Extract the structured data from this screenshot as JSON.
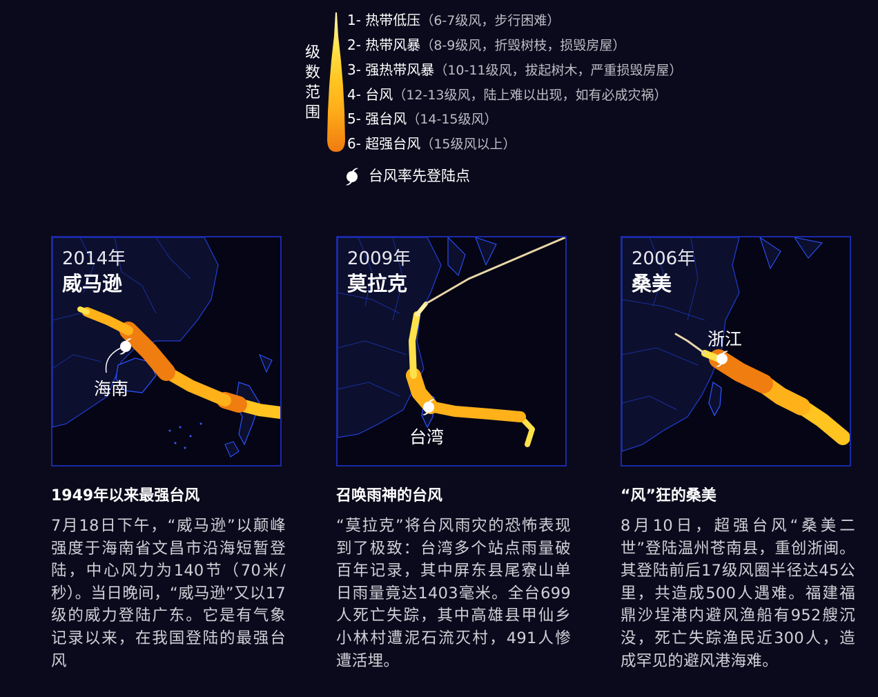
{
  "legend": {
    "title_chars": [
      "级",
      "数",
      "范",
      "围"
    ],
    "levels": [
      {
        "level": "1- 热带低压",
        "desc": "（6-7级风，步行困难）",
        "color": "#fff2a6"
      },
      {
        "level": "2- 热带风暴",
        "desc": "（8-9级风，折毁树枝，损毁房屋）",
        "color": "#ffe14a"
      },
      {
        "level": "3- 强热带风暴",
        "desc": "（10-11级风，拔起树木，严重损毁房屋）",
        "color": "#ffcb1f"
      },
      {
        "level": "4- 台风",
        "desc": "（12-13级风，陆上难以出现，如有必成灾祸）",
        "color": "#ffb11a"
      },
      {
        "level": "5- 强台风",
        "desc": "（14-15级风）",
        "color": "#f99a14"
      },
      {
        "level": "6- 超强台风",
        "desc": "（15级风以上）",
        "color": "#ef7d0f"
      }
    ],
    "landfall_label": "台风率先登陆点",
    "landfall_icon": "typhoon-landfall-icon"
  },
  "cards": [
    {
      "year": "2014年",
      "name": "威马逊",
      "place": "海南",
      "headline": "1949年以来最强台风",
      "body": "7月18日下午，“威马逊”以颠峰强度于海南省文昌市沿海短暂登陆，中心风力为140节（70米/秒）。当日晚间，“威马逊”又以17级的威力登陆广东。它是有气象记录以来，在我国登陆的最强台风"
    },
    {
      "year": "2009年",
      "name": "莫拉克",
      "place": "台湾",
      "headline": "召唤雨神的台风",
      "body": "“莫拉克”将台风雨灾的恐怖表现到了极致：台湾多个站点雨量破百年记录，其中屏东县尾寮山单日雨量竟达1403毫米。全台699人死亡失踪，其中高雄县甲仙乡小林村遭泥石流灭村，491人惨遭活埋。"
    },
    {
      "year": "2006年",
      "name": "桑美",
      "place": "浙江",
      "headline": "“风”狂的桑美",
      "body": "8月10日，超强台风“桑美二世”登陆温州苍南县，重创浙闽。其登陆前后17级风圈半径达45公里，共造成500人遇难。福建福鼎沙埕港内避风渔船有952艘沉没，死亡失踪渔民近300人，造成罕见的避风港海难。"
    }
  ]
}
